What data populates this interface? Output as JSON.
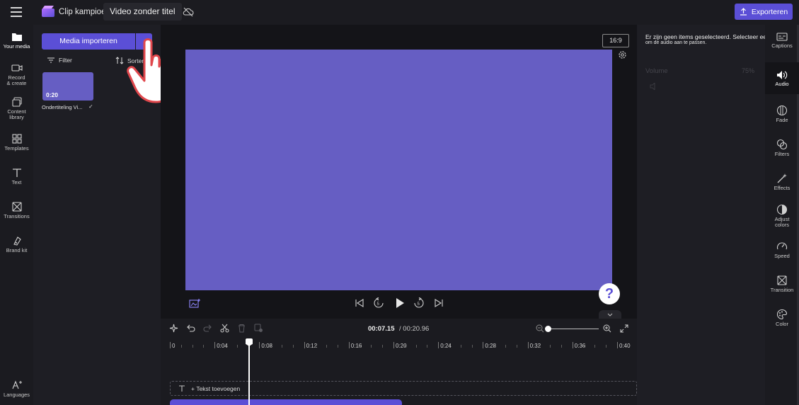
{
  "app": {
    "name": "Clip kampioen",
    "document_title": "Video zonder titel"
  },
  "header": {
    "export_label": "Exporteren"
  },
  "left_nav": [
    {
      "label": "Your media",
      "icon": "folder-icon",
      "active": true
    },
    {
      "label": "Record & create",
      "icon": "camera-icon"
    },
    {
      "label": "Content library",
      "icon": "library-icon"
    },
    {
      "label": "Templates",
      "icon": "templates-icon"
    },
    {
      "label": "Text",
      "icon": "text-icon"
    },
    {
      "label": "Transitions",
      "icon": "transitions-icon"
    },
    {
      "label": "Brand kit",
      "icon": "brand-kit-icon"
    },
    {
      "label": "Languages",
      "icon": "languages-icon"
    }
  ],
  "media": {
    "import_label": "Media importeren",
    "filter_label": "Filter",
    "sort_label": "Sorteren",
    "items": [
      {
        "duration": "0:20",
        "name": "Ondertiteling Vi...",
        "added": true
      }
    ]
  },
  "preview": {
    "aspect_ratio": "16:9",
    "background_color": "#665ec3"
  },
  "timeline": {
    "current_time": "00:07.15",
    "separator": " / ",
    "total_time": "00:20.96",
    "ticks": [
      "0",
      "0:04",
      "0:08",
      "0:12",
      "0:16",
      "0:20",
      "0:24",
      "0:28",
      "0:32",
      "0:36",
      "0:40"
    ],
    "add_text_label": "Tekst toevoegen"
  },
  "properties": {
    "empty_message": "Er zijn geen items geselecteerd. Selecteer een item",
    "empty_message_sub": "om de audio aan te passen.",
    "volume_label": "Volume",
    "volume_value": "75%"
  },
  "right_nav": [
    {
      "label": "Captions",
      "icon": "captions-icon"
    },
    {
      "label": "Audio",
      "icon": "audio-icon",
      "active": true
    },
    {
      "label": "Fade",
      "icon": "fade-icon"
    },
    {
      "label": "Filters",
      "icon": "filters-icon"
    },
    {
      "label": "Effects",
      "icon": "effects-icon"
    },
    {
      "label": "Adjust colors",
      "icon": "adjust-colors-icon"
    },
    {
      "label": "Speed",
      "icon": "speed-icon"
    },
    {
      "label": "Transition",
      "icon": "transition-icon"
    },
    {
      "label": "Color",
      "icon": "color-icon"
    }
  ],
  "colors": {
    "accent": "#5b4fd6",
    "preview": "#665ec3",
    "background": "#141418",
    "panel": "#1e1e24"
  }
}
